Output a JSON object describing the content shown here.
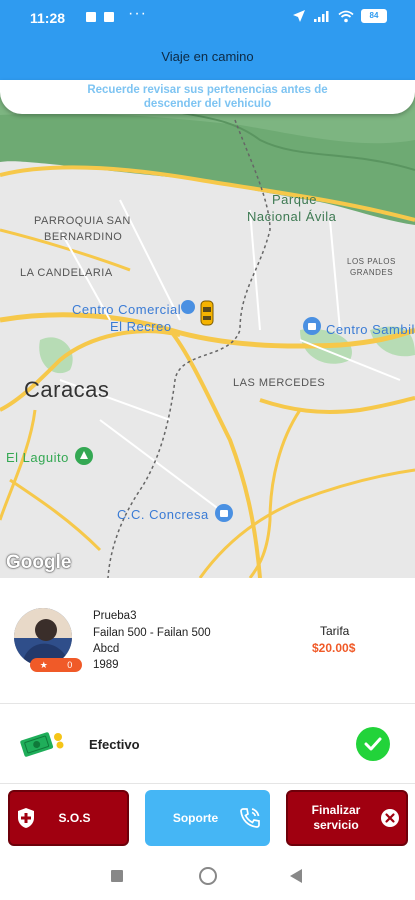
{
  "status_bar": {
    "time": "11:28",
    "dots": "···",
    "battery": "84"
  },
  "header": {
    "title": "Viaje en camino"
  },
  "notice": {
    "line1": "Recuerde revisar sus pertenencias antes de",
    "line2": "descender del vehiculo"
  },
  "map": {
    "labels": {
      "parque": "Parque",
      "avila": "Nacional Ávila",
      "parroquia": "PARROQUIA SAN",
      "bernardino": "BERNARDINO",
      "candelaria": "LA CANDELARIA",
      "palos1": "LOS PALOS",
      "palos2": "GRANDES",
      "cc1": "Centro Comercial",
      "cc2": "El Recreo",
      "sambil": "Centro Sambil",
      "caracas": "Caracas",
      "mercedes": "LAS MERCEDES",
      "laguito": "El Laguito",
      "concresa": "C.C. Concresa"
    },
    "google": "Google"
  },
  "driver": {
    "name": "Prueba3",
    "vehicle": "Failan 500 - Failan 500",
    "plate": "Abcd",
    "year": "1989",
    "rating": "0",
    "tarifa_label": "Tarifa",
    "tarifa_value": "$20.00$"
  },
  "payment": {
    "method": "Efectivo",
    "icon": "cash-icon",
    "status_icon": "check-icon"
  },
  "buttons": {
    "sos": "S.O.S",
    "soporte": "Soporte",
    "finalizar1": "Finalizar",
    "finalizar2": "servicio"
  },
  "colors": {
    "primary": "#2f9bf0",
    "danger": "#a00010",
    "support": "#45b6f5",
    "accent": "#f05a28",
    "success": "#22d33a"
  }
}
